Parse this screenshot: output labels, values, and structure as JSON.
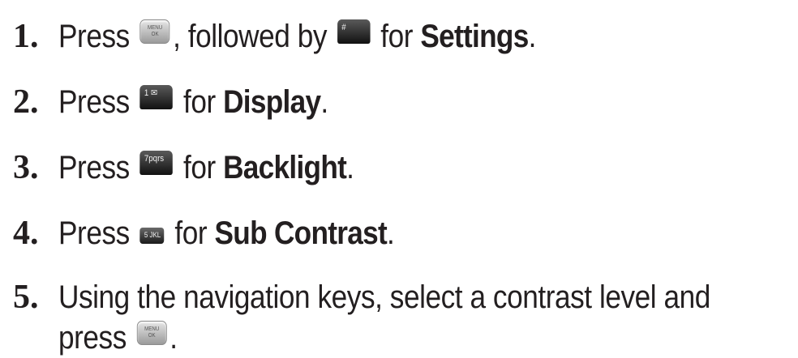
{
  "steps": [
    {
      "number": "1.",
      "pre": "Press ",
      "key1": {
        "icon": "menu-ok-key-icon",
        "line1": "MENU",
        "line2": "OK"
      },
      "mid": ", followed by ",
      "key2": {
        "icon": "hash-space-key-icon",
        "label": "#"
      },
      "post": " for ",
      "bold": "Settings",
      "end": "."
    },
    {
      "number": "2.",
      "pre": "Press ",
      "key": {
        "icon": "key-1-icon",
        "label": "1 ✉"
      },
      "post": " for ",
      "bold": "Display",
      "end": "."
    },
    {
      "number": "3.",
      "pre": "Press ",
      "key": {
        "icon": "key-7-pqrs-icon",
        "label": "7pqrs"
      },
      "post": " for ",
      "bold": "Backlight",
      "end": "."
    },
    {
      "number": "4.",
      "pre": "Press ",
      "key": {
        "icon": "key-5-jkl-icon",
        "label": "5 JKL"
      },
      "post": " for ",
      "bold": "Sub Contrast",
      "end": "."
    },
    {
      "number": "5.",
      "line1": "Using the navigation keys, select a contrast level and",
      "pre": "press ",
      "key": {
        "icon": "menu-ok-key-icon",
        "line1": "MENU",
        "line2": "OK"
      },
      "end": "."
    }
  ]
}
